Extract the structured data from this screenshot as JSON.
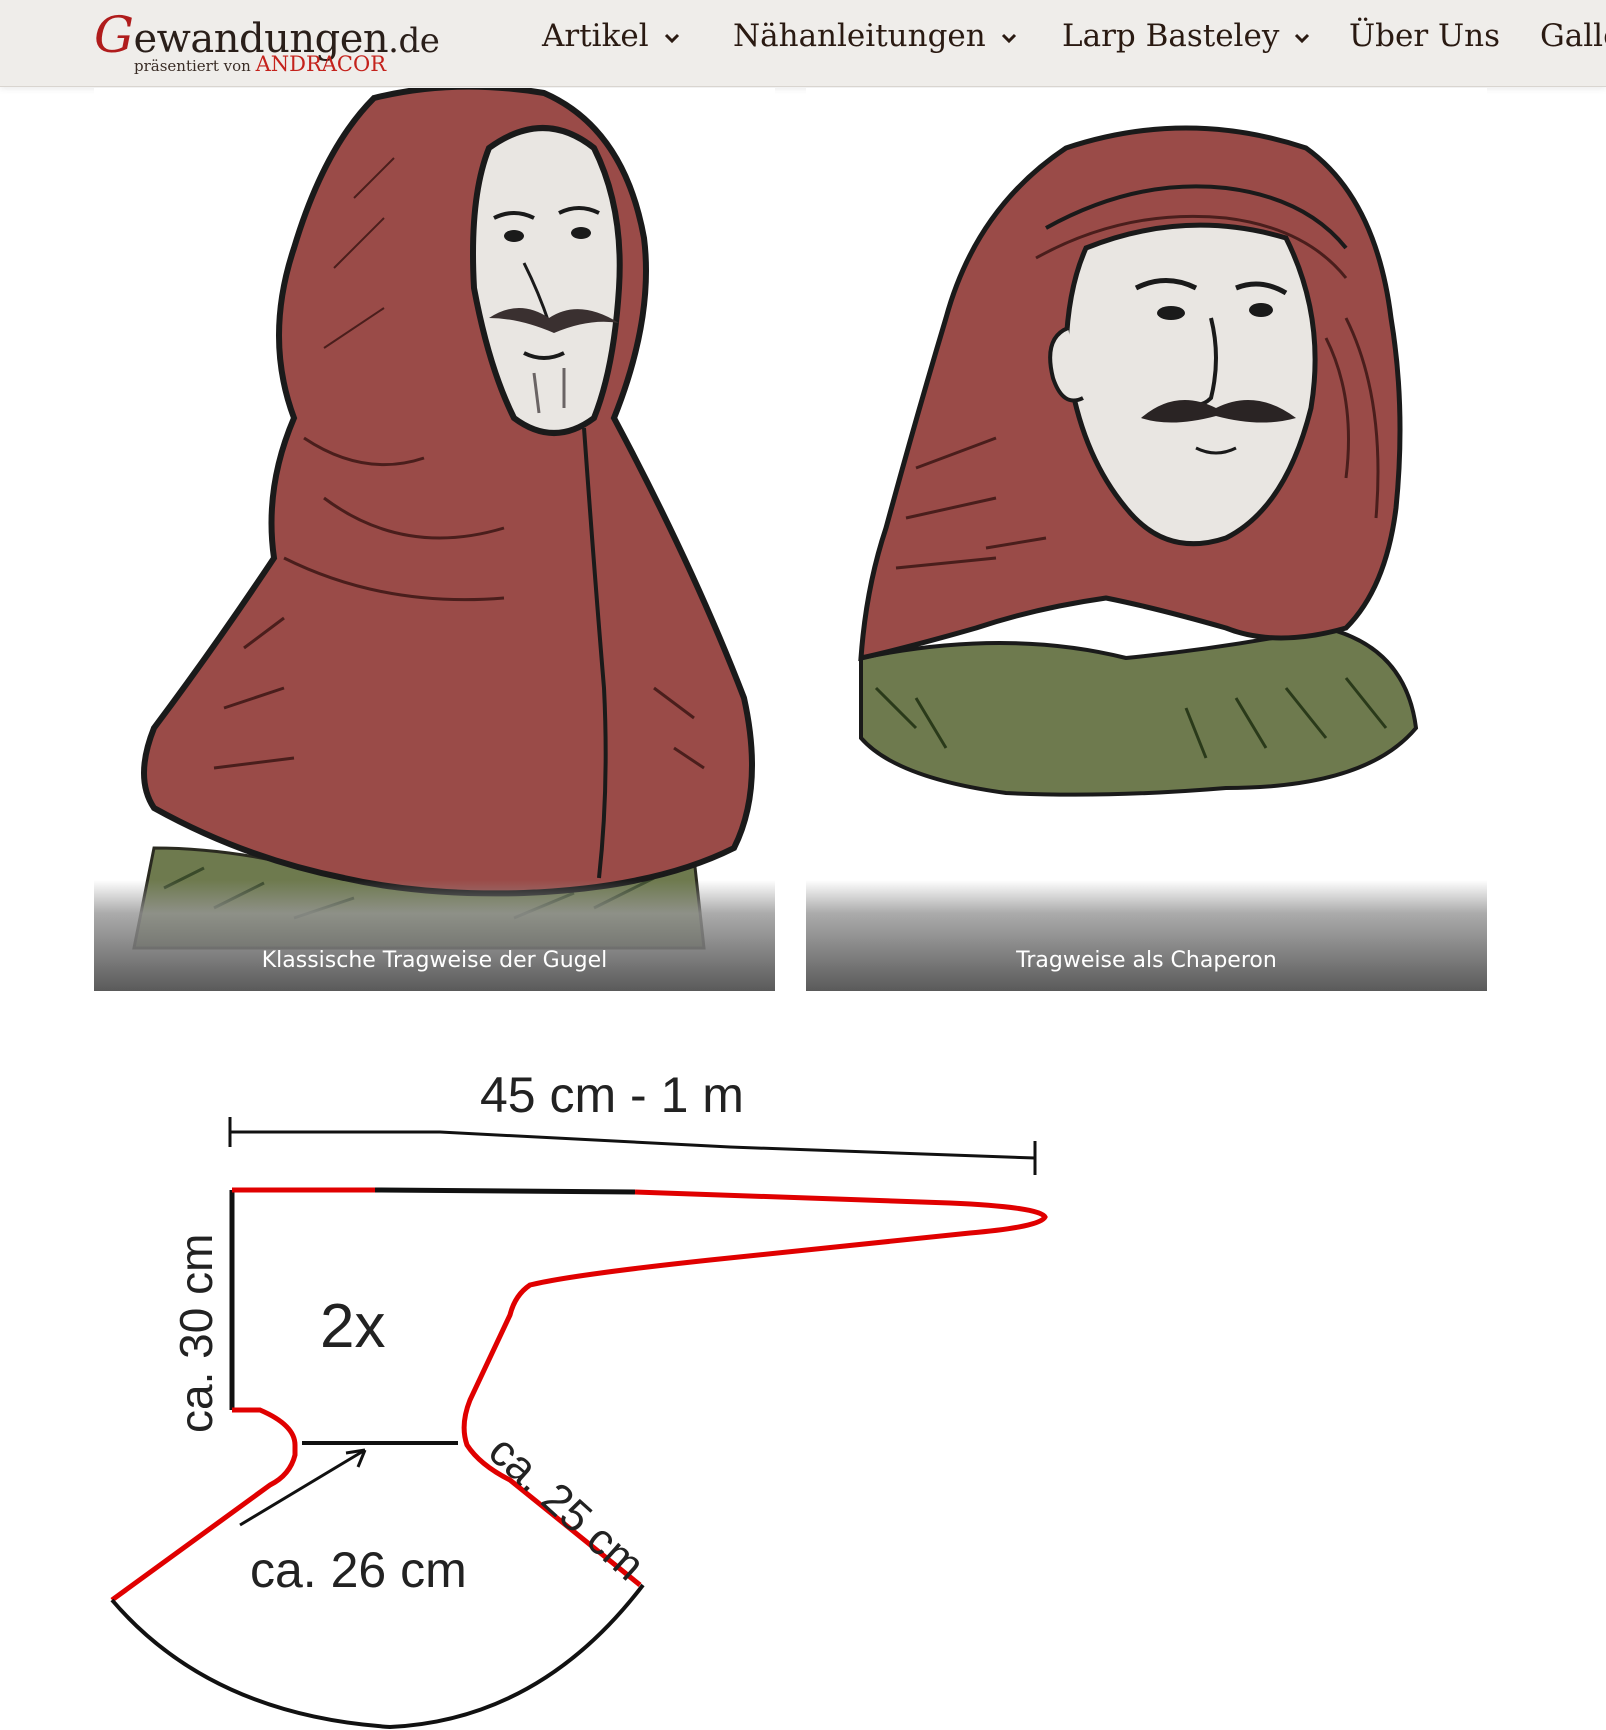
{
  "header": {
    "logo": {
      "title": "Gewandungen",
      "tld": ".de",
      "subtitle": "präsentiert von",
      "brand": "ANDRACOR"
    },
    "nav": [
      {
        "label": "Artikel",
        "has_dropdown": true
      },
      {
        "label": "Nähanleitungen",
        "has_dropdown": true
      },
      {
        "label": "Larp Basteley",
        "has_dropdown": true
      },
      {
        "label": "Über Uns",
        "has_dropdown": false
      },
      {
        "label": "Galle",
        "has_dropdown": false
      }
    ]
  },
  "gallery": [
    {
      "caption": "Klassische Tragweise der Gugel"
    },
    {
      "caption": "Tragweise als Chaperon"
    }
  ],
  "pattern": {
    "width_label": "45 cm - 1 m",
    "height_label": "ca. 30 cm",
    "count_label": "2x",
    "neck_label": "ca. 26 cm",
    "side_label": "ca. 25 cm"
  },
  "colors": {
    "hood_red": "#9a4b48",
    "tunic_green": "#6e7a4e",
    "pattern_red": "#e00000",
    "logo_red": "#b01c1c"
  }
}
